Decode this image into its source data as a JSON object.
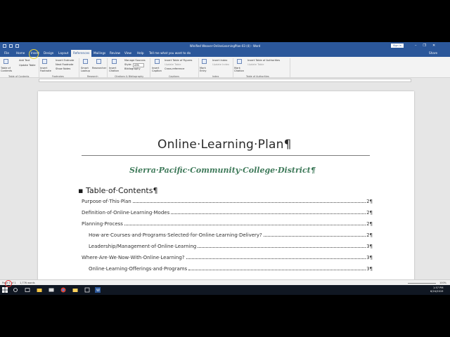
{
  "window": {
    "title": "Winified Weaver-OnlineLearningPlan-03 (4) - Word",
    "sign_in": "Sign in"
  },
  "tabs": [
    {
      "label": "File"
    },
    {
      "label": "Home"
    },
    {
      "label": "Insert"
    },
    {
      "label": "Design"
    },
    {
      "label": "Layout"
    },
    {
      "label": "References"
    },
    {
      "label": "Mailings"
    },
    {
      "label": "Review"
    },
    {
      "label": "View"
    },
    {
      "label": "Help"
    }
  ],
  "tell_me": "Tell me what you want to do",
  "share": "Share",
  "ribbon": {
    "table_of_contents": "Table of Contents",
    "add_text": "Add Text",
    "update_table": "Update Table",
    "insert_footnote": "Insert Footnote",
    "insert_endnote": "Insert Endnote",
    "next_footnote": "Next Footnote",
    "show_notes": "Show Notes",
    "smart_lookup": "Smart Lookup",
    "researcher": "Researcher",
    "insert_citation": "Insert Citation",
    "manage_sources": "Manage Sources",
    "style_label": "Style:",
    "style_value": "APA",
    "bibliography": "Bibliography",
    "insert_caption": "Insert Caption",
    "insert_table_of_figures": "Insert Table of Figures",
    "update_table_captions": "Update Table",
    "cross_reference": "Cross-reference",
    "mark_entry": "Mark Entry",
    "insert_index": "Insert Index",
    "update_index": "Update Index",
    "mark_citation": "Mark Citation",
    "insert_table_of_authorities": "Insert Table of Authorities",
    "update_table_authorities": "Update Table",
    "groups": {
      "toc": "Table of Contents",
      "footnotes": "Footnotes",
      "research": "Research",
      "citations": "Citations & Bibliography",
      "captions": "Captions",
      "index": "Index",
      "authorities": "Table of Authorities"
    }
  },
  "document": {
    "title": "Online·Learning·Plan¶",
    "subtitle": "Sierra·Pacific·Community·College·District¶",
    "toc_heading": "Table·of·Contents¶",
    "toc_entries": [
      {
        "text": "Purpose·of·This·Plan",
        "page": "2¶"
      },
      {
        "text": "Definition·of·Online·Learning·Modes",
        "page": "2¶"
      },
      {
        "text": "Planning·Process",
        "page": "2¶"
      },
      {
        "text": "How·are·Courses·and·Programs·Selected·for·Online·Learning·Delivery?",
        "page": "2¶"
      },
      {
        "text": "Leadership/Management·of·Online·Learning",
        "page": "3¶"
      },
      {
        "text": "Where·Are·We·Now·With·Online·Learning?",
        "page": "3¶"
      },
      {
        "text": "Online·Learning·Offerings·and·Programs",
        "page": "3¶"
      }
    ]
  },
  "status": {
    "page": "Page 1 of 1",
    "words": "1,776 words",
    "zoom": "100%"
  },
  "taskbar": {
    "time": "1:57 PM",
    "date": "6/24/2019"
  }
}
